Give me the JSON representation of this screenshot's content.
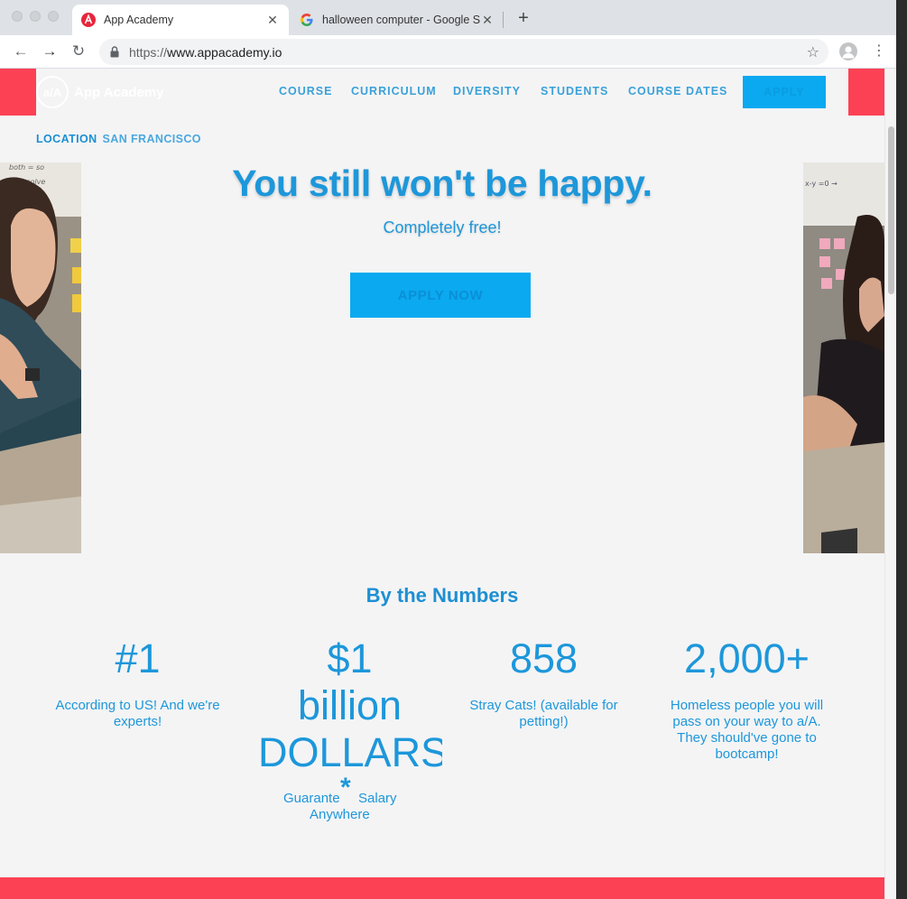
{
  "browser": {
    "active_tab": {
      "title": "App Academy",
      "close": "✕"
    },
    "inactive_tab": {
      "title": "halloween computer - Google S",
      "close": "✕"
    },
    "new_tab": "+",
    "url_scheme": "https://",
    "url_host": "www.appacademy.io",
    "back": "←",
    "forward": "→",
    "reload": "↻",
    "star": "☆",
    "menu": "⋮"
  },
  "header": {
    "brand_mark": "a/A",
    "brand_name": "App Academy",
    "nav": [
      "COURSE",
      "CURRICULUM",
      "DIVERSITY",
      "STUDENTS",
      "COURSE DATES"
    ],
    "apply": "APPLY",
    "location_label": "LOCATION",
    "location_value": "SAN FRANCISCO"
  },
  "hero": {
    "title": "You still won't be happy.",
    "subtitle": "Completely free!",
    "cta": "APPLY NOW"
  },
  "numbers": {
    "title": "By the Numbers",
    "stats": [
      {
        "value": "#1",
        "desc": "According to US! And we're experts!"
      },
      {
        "value_line1": "$1",
        "value_line2": "billion",
        "value_line3": "DOLLARS",
        "asterisk": "*",
        "desc_a": "Guarante",
        "desc_b": "Salary",
        "desc_c": "Anywhere"
      },
      {
        "value": "858",
        "desc": "Stray Cats! (available for petting!)"
      },
      {
        "value": "2,000+",
        "desc": "Homeless people you will pass on your way to a/A. They should've gone to bootcamp!"
      }
    ]
  },
  "colors": {
    "brand_red": "#fd4155",
    "accent_blue": "#1d97da",
    "button_blue": "#0aa9f0",
    "page_bg": "#f4f4f5"
  },
  "icons": {
    "tab_favicon": "app-academy-favicon",
    "google_favicon": "google-icon",
    "lock": "lock-icon",
    "profile": "profile-icon"
  }
}
